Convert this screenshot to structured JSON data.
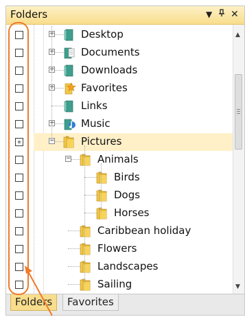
{
  "colors": {
    "accent": "#f8dd8c",
    "selection": "#fff0c8",
    "highlight_outline": "#ef7a2a",
    "folder_yellow": "#f2c744"
  },
  "panel": {
    "title": "Folders",
    "menu_icon": "dropdown-triangle-icon",
    "pin_icon": "pin-icon",
    "close_icon": "close-icon"
  },
  "tree": {
    "items": [
      {
        "label": "Desktop",
        "icon": "desktop-folder-icon",
        "level": 1,
        "expander": "+"
      },
      {
        "label": "Documents",
        "icon": "documents-folder-icon",
        "level": 1,
        "expander": "+"
      },
      {
        "label": "Downloads",
        "icon": "downloads-folder-icon",
        "level": 1,
        "expander": "+"
      },
      {
        "label": "Favorites",
        "icon": "favorites-star-folder-icon",
        "level": 1,
        "expander": "+"
      },
      {
        "label": "Links",
        "icon": "links-folder-icon",
        "level": 1,
        "expander": ""
      },
      {
        "label": "Music",
        "icon": "music-folder-icon",
        "level": 1,
        "expander": "+"
      },
      {
        "label": "Pictures",
        "icon": "folder-icon",
        "level": 1,
        "expander": "-",
        "selected": true
      },
      {
        "label": "Animals",
        "icon": "folder-icon",
        "level": 2,
        "expander": "-"
      },
      {
        "label": "Birds",
        "icon": "folder-icon",
        "level": 3,
        "expander": ""
      },
      {
        "label": "Dogs",
        "icon": "folder-icon",
        "level": 3,
        "expander": ""
      },
      {
        "label": "Horses",
        "icon": "folder-icon",
        "level": 3,
        "expander": ""
      },
      {
        "label": "Caribbean holiday",
        "icon": "folder-icon",
        "level": 2,
        "expander": ""
      },
      {
        "label": "Flowers",
        "icon": "folder-icon",
        "level": 2,
        "expander": ""
      },
      {
        "label": "Landscapes",
        "icon": "folder-icon",
        "level": 2,
        "expander": ""
      },
      {
        "label": "Sailing",
        "icon": "folder-icon",
        "level": 2,
        "expander": ""
      }
    ],
    "checkbox_states": [
      "unchecked",
      "unchecked",
      "unchecked",
      "unchecked",
      "unchecked",
      "unchecked",
      "indeterminate",
      "unchecked",
      "unchecked",
      "unchecked",
      "unchecked",
      "unchecked",
      "unchecked",
      "unchecked",
      "unchecked"
    ]
  },
  "tabs": [
    {
      "label": "Folders",
      "active": true
    },
    {
      "label": "Favorites",
      "active": false
    }
  ]
}
